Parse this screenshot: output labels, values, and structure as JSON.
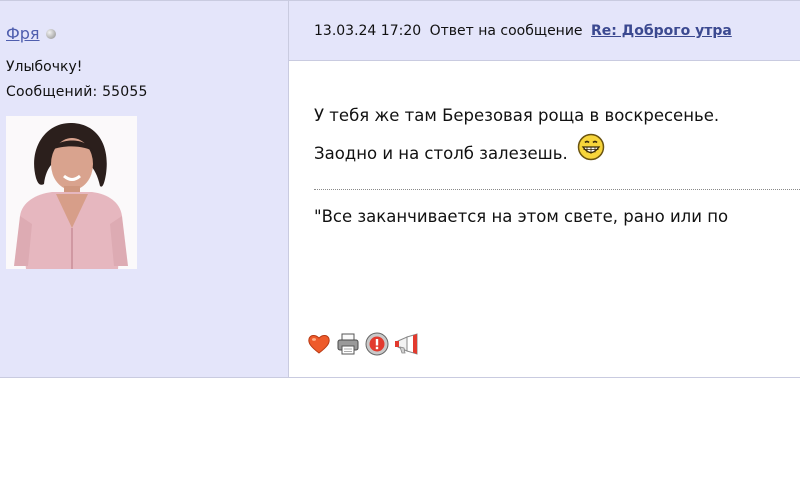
{
  "post": {
    "author": {
      "name": "Фря",
      "online_status": "offline",
      "status_text": "Улыбочку!",
      "posts_label": "Сообщений:",
      "posts_count": "55055",
      "avatar_icon": "user-photo"
    },
    "header": {
      "datetime": "13.03.24 17:20",
      "reply_prefix": "Ответ на сообщение",
      "reply_link": "Re: Доброго утра"
    },
    "body": {
      "line1": "У тебя же там Березовая роща в воскресенье.",
      "line2": "Заодно и на столб залезешь."
    },
    "signature": "\"Все заканчивается на этом свете, рано или по",
    "actions": [
      {
        "icon": "heart-icon"
      },
      {
        "icon": "printer-icon"
      },
      {
        "icon": "alert-icon"
      },
      {
        "icon": "megaphone-icon"
      }
    ],
    "colors": {
      "panel_bg": "#e4e5fa",
      "link": "#4f5eae",
      "reply_link": "#3b4990"
    }
  }
}
